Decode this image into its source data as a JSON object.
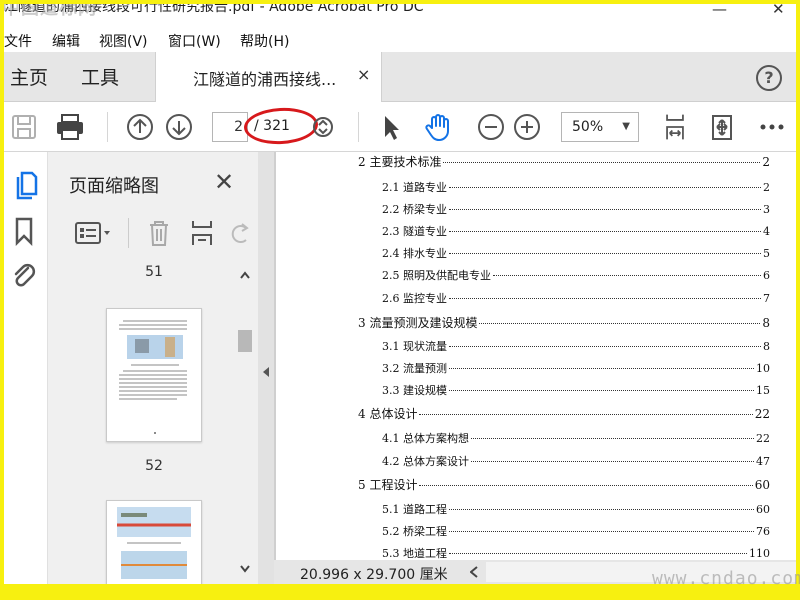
{
  "window": {
    "title": "江隧道的浦西接线段可行性研究报告.pdf - Adobe Acrobat Pro DC",
    "logo_text": "中国道标网"
  },
  "menu": [
    "文件",
    "编辑",
    "视图(V)",
    "窗口(W)",
    "帮助(H)"
  ],
  "tabs": {
    "home": "主页",
    "tools": "工具",
    "document": "江隧道的浦西接线...",
    "close_glyph": "×",
    "help_glyph": "?"
  },
  "toolbar": {
    "page_current": "2",
    "page_total": "/ 321",
    "zoom": "50%"
  },
  "thumbnails": {
    "title": "页面缩略图",
    "pages": [
      "51",
      "52"
    ]
  },
  "toc": [
    {
      "level": 1,
      "label": "2 主要技术标准",
      "page": "2"
    },
    {
      "level": 2,
      "label": "2.1 道路专业",
      "page": "2"
    },
    {
      "level": 2,
      "label": "2.2 桥梁专业",
      "page": "3"
    },
    {
      "level": 2,
      "label": "2.3 隧道专业",
      "page": "4"
    },
    {
      "level": 2,
      "label": "2.4 排水专业",
      "page": "5"
    },
    {
      "level": 2,
      "label": "2.5 照明及供配电专业",
      "page": "6"
    },
    {
      "level": 2,
      "label": "2.6 监控专业",
      "page": "7"
    },
    {
      "level": 1,
      "label": "3 流量预测及建设规模",
      "page": "8"
    },
    {
      "level": 2,
      "label": "3.1 现状流量",
      "page": "8"
    },
    {
      "level": 2,
      "label": "3.2 流量预测",
      "page": "10"
    },
    {
      "level": 2,
      "label": "3.3 建设规模",
      "page": "15"
    },
    {
      "level": 1,
      "label": "4 总体设计",
      "page": "22"
    },
    {
      "level": 2,
      "label": "4.1 总体方案构想",
      "page": "22"
    },
    {
      "level": 2,
      "label": "4.2 总体方案设计",
      "page": "47"
    },
    {
      "level": 1,
      "label": "5 工程设计",
      "page": "60"
    },
    {
      "level": 2,
      "label": "5.1 道路工程",
      "page": "60"
    },
    {
      "level": 2,
      "label": "5.2 桥梁工程",
      "page": "76"
    },
    {
      "level": 2,
      "label": "5.3 地道工程",
      "page": "110"
    }
  ],
  "status": {
    "page_size": "20.996 x 29.700 厘米"
  },
  "watermark": "www.cndao.com",
  "colors": {
    "frame": "#f7f010",
    "highlight_oval": "#d7191c"
  }
}
